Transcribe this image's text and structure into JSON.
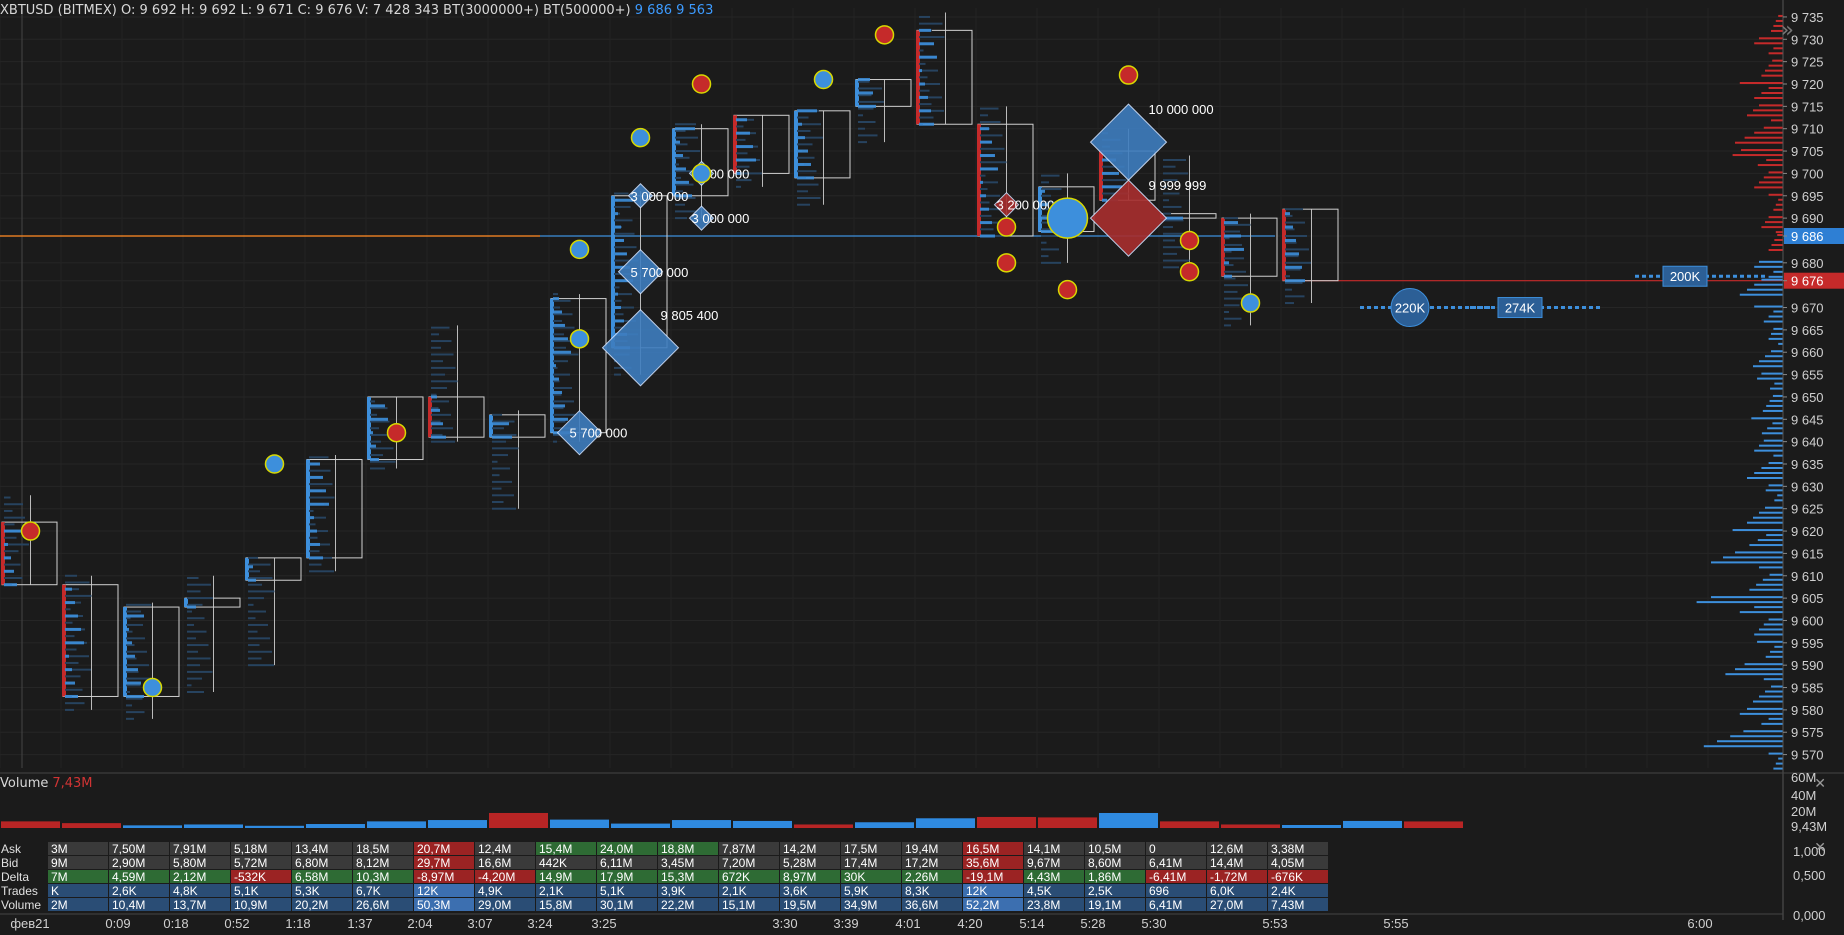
{
  "header": {
    "symbol": "XBTUSD (BITMEX)",
    "ohlcv": "O: 9 692  H: 9 692  L: 9 671  C: 9 676  V: 7 428 343  BT(3000000+)  BT(500000+)",
    "current": "9 686  9 563"
  },
  "price_scale": {
    "labels": [
      "9 735",
      "9 730",
      "9 725",
      "9 720",
      "9 715",
      "9 710",
      "9 705",
      "9 700",
      "9 695",
      "9 690",
      "9 686",
      "9 680",
      "9 676",
      "9 670",
      "9 665",
      "9 660",
      "9 655",
      "9 650",
      "9 645",
      "9 640",
      "9 635",
      "9 630",
      "9 625",
      "9 620",
      "9 615",
      "9 610",
      "9 605",
      "9 600",
      "9 595",
      "9 590",
      "9 585",
      "9 580",
      "9 575",
      "9 570"
    ],
    "highlight_blue": "9 686",
    "highlight_red": "9 676"
  },
  "volume_panel": {
    "title": "Volume",
    "value": "7,43M",
    "scale": [
      "60M",
      "40M",
      "20M",
      "9,43M"
    ]
  },
  "stats_panel": {
    "row_labels": [
      "Ask",
      "Bid",
      "Delta",
      "Trades",
      "Volume"
    ],
    "scale": [
      "1,000",
      "0,500",
      "0,000"
    ]
  },
  "time_axis": [
    "фев21",
    "0:09",
    "0:18",
    "0:52",
    "1:18",
    "1:37",
    "2:04",
    "3:07",
    "3:24",
    "3:25",
    "3:30",
    "3:39",
    "4:01",
    "4:20",
    "5:14",
    "5:28",
    "5:30",
    "5:53",
    "5:55",
    "6:00"
  ],
  "chart_data": {
    "type": "footprint",
    "ylim": [
      9567,
      9737
    ],
    "candles": [
      {
        "o": 9622,
        "h": 9628,
        "l": 9608,
        "c": 9608,
        "dir": "down"
      },
      {
        "o": 9608,
        "h": 9610,
        "l": 9580,
        "c": 9583,
        "dir": "down"
      },
      {
        "o": 9583,
        "h": 9604,
        "l": 9578,
        "c": 9603,
        "dir": "up"
      },
      {
        "o": 9603,
        "h": 9610,
        "l": 9584,
        "c": 9605,
        "dir": "up"
      },
      {
        "o": 9609,
        "h": 9614,
        "l": 9590,
        "c": 9614,
        "dir": "up"
      },
      {
        "o": 9614,
        "h": 9637,
        "l": 9611,
        "c": 9636,
        "dir": "up"
      },
      {
        "o": 9636,
        "h": 9650,
        "l": 9634,
        "c": 9650,
        "dir": "up"
      },
      {
        "o": 9650,
        "h": 9666,
        "l": 9640,
        "c": 9641,
        "dir": "down"
      },
      {
        "o": 9641,
        "h": 9647,
        "l": 9625,
        "c": 9646,
        "dir": "up"
      },
      {
        "o": 9642,
        "h": 9673,
        "l": 9640,
        "c": 9672,
        "dir": "up"
      },
      {
        "o": 9661,
        "h": 9696,
        "l": 9655,
        "c": 9695,
        "dir": "up"
      },
      {
        "o": 9695,
        "h": 9711,
        "l": 9690,
        "c": 9710,
        "dir": "up"
      },
      {
        "o": 9700,
        "h": 9713,
        "l": 9697,
        "c": 9713,
        "dir": "down"
      },
      {
        "o": 9699,
        "h": 9714,
        "l": 9693,
        "c": 9714,
        "dir": "up"
      },
      {
        "o": 9715,
        "h": 9721,
        "l": 9707,
        "c": 9721,
        "dir": "up"
      },
      {
        "o": 9732,
        "h": 9736,
        "l": 9711,
        "c": 9711,
        "dir": "down"
      },
      {
        "o": 9711,
        "h": 9715,
        "l": 9686,
        "c": 9686,
        "dir": "down"
      },
      {
        "o": 9697,
        "h": 9700,
        "l": 9680,
        "c": 9687,
        "dir": "up"
      },
      {
        "o": 9705,
        "h": 9710,
        "l": 9694,
        "c": 9694,
        "dir": "down"
      },
      {
        "o": 9690,
        "h": 9704,
        "l": 9679,
        "c": 9691,
        "dir": "down"
      },
      {
        "o": 9690,
        "h": 9691,
        "l": 9666,
        "c": 9677,
        "dir": "down"
      },
      {
        "o": 9692,
        "h": 9692,
        "l": 9671,
        "c": 9676,
        "dir": "down"
      }
    ],
    "big_trades": [
      {
        "candle": 16,
        "price": 9693,
        "size": "3 200 000",
        "color": "red"
      },
      {
        "candle": 11,
        "price": 9700,
        "size": "3 000 000",
        "color": "blue"
      },
      {
        "candle": 10,
        "price": 9695,
        "size": "3 000 000",
        "color": "blue"
      },
      {
        "candle": 11,
        "price": 9690,
        "size": "3 000 000",
        "color": "blue"
      },
      {
        "candle": 10,
        "price": 9678,
        "size": "5 700 000",
        "color": "blue"
      },
      {
        "candle": 9,
        "price": 9642,
        "size": "5 700 000",
        "color": "blue"
      },
      {
        "candle": 10,
        "price": 9661,
        "size": "9 805 400",
        "color": "blue"
      },
      {
        "candle": 18,
        "price": 9707,
        "size": "10 000 000",
        "color": "blue"
      },
      {
        "candle": 18,
        "price": 9690,
        "size": "9 999 999",
        "color": "red"
      }
    ],
    "levels": [
      "220K",
      "274K",
      "200K"
    ],
    "volume": {
      "values": [
        7.5,
        5.5,
        3,
        4,
        2.5,
        4.5,
        7.5,
        9,
        17,
        9.5,
        5,
        9,
        8,
        4,
        6.5,
        11,
        12.5,
        12,
        17,
        7.5,
        4,
        3.4,
        8,
        7.43
      ],
      "colors": [
        "red",
        "red",
        "blue",
        "blue",
        "blue",
        "blue",
        "blue",
        "blue",
        "red",
        "blue",
        "blue",
        "blue",
        "blue",
        "red",
        "blue",
        "blue",
        "red",
        "red",
        "blue",
        "red",
        "red",
        "blue",
        "blue",
        "red"
      ]
    },
    "stats": {
      "Ask": [
        "3M",
        "7,50M",
        "7,91M",
        "5,18M",
        "13,4M",
        "18,5M",
        "20,7M",
        "12,4M",
        "15,4M",
        "24,0M",
        "18,8M",
        "7,87M",
        "14,2M",
        "17,5M",
        "19,4M",
        "16,5M",
        "14,1M",
        "10,5M",
        "0",
        "12,6M",
        "3,38M"
      ],
      "Bid": [
        "9M",
        "2,90M",
        "5,80M",
        "5,72M",
        "6,80M",
        "8,12M",
        "29,7M",
        "16,6M",
        "442K",
        "6,11M",
        "3,45M",
        "7,20M",
        "5,28M",
        "17,4M",
        "17,2M",
        "35,6M",
        "9,67M",
        "8,60M",
        "6,41M",
        "14,4M",
        "4,05M"
      ],
      "Delta": [
        "7M",
        "4,59M",
        "2,12M",
        "-532K",
        "6,58M",
        "10,3M",
        "-8,97M",
        "-4,20M",
        "14,9M",
        "17,9M",
        "15,3M",
        "672K",
        "8,97M",
        "30K",
        "2,26M",
        "-19,1M",
        "4,43M",
        "1,86M",
        "-6,41M",
        "-1,72M",
        "-676K"
      ],
      "Trades": [
        "K",
        "2,6K",
        "4,8K",
        "5,1K",
        "5,3K",
        "6,7K",
        "12K",
        "4,9K",
        "2,1K",
        "5,1K",
        "3,9K",
        "2,1K",
        "3,6K",
        "5,9K",
        "8,3K",
        "12K",
        "4,5K",
        "2,5K",
        "696",
        "6,0K",
        "2,4K"
      ],
      "Volume": [
        "2M",
        "10,4M",
        "13,7M",
        "10,9M",
        "20,2M",
        "26,6M",
        "50,3M",
        "29,0M",
        "15,8M",
        "30,1M",
        "22,2M",
        "15,1M",
        "19,5M",
        "34,9M",
        "36,6M",
        "52,2M",
        "23,8M",
        "19,1M",
        "6,41M",
        "27,0M",
        "7,43M"
      ]
    },
    "dom": [
      0.1,
      0.2,
      0.15,
      0.3,
      0.25,
      0.4,
      0.35,
      0.2,
      0.1,
      0.15,
      0.12,
      0.2,
      0.3,
      0.2,
      0.1,
      0.25,
      0.18,
      0.14,
      0.22,
      0.2,
      0.3,
      0.12,
      0.25,
      0.35,
      0.5,
      0.28,
      0.6,
      0.2,
      0.18,
      0.4,
      0.25,
      0.3,
      0.55,
      0.1
    ]
  }
}
